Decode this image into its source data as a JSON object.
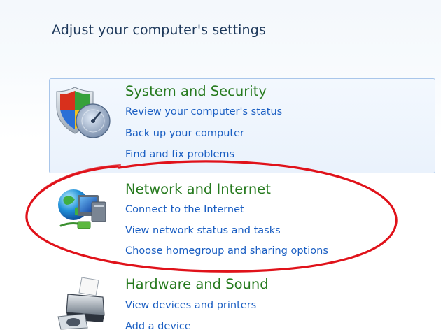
{
  "page": {
    "title": "Adjust your computer's settings"
  },
  "categories": [
    {
      "title": "System and Security",
      "icon": "shield-icon",
      "links": [
        "Review your computer's status",
        "Back up your computer",
        "Find and fix problems"
      ]
    },
    {
      "title": "Network and Internet",
      "icon": "network-globe-icon",
      "links": [
        "Connect to the Internet",
        "View network status and tasks",
        "Choose homegroup and sharing options"
      ]
    },
    {
      "title": "Hardware and Sound",
      "icon": "printer-icon",
      "links": [
        "View devices and printers",
        "Add a device"
      ]
    }
  ],
  "colors": {
    "category_title": "#267a1e",
    "link": "#1a5ec2",
    "heading": "#1e395b",
    "highlight_annotation": "#e0121a"
  }
}
